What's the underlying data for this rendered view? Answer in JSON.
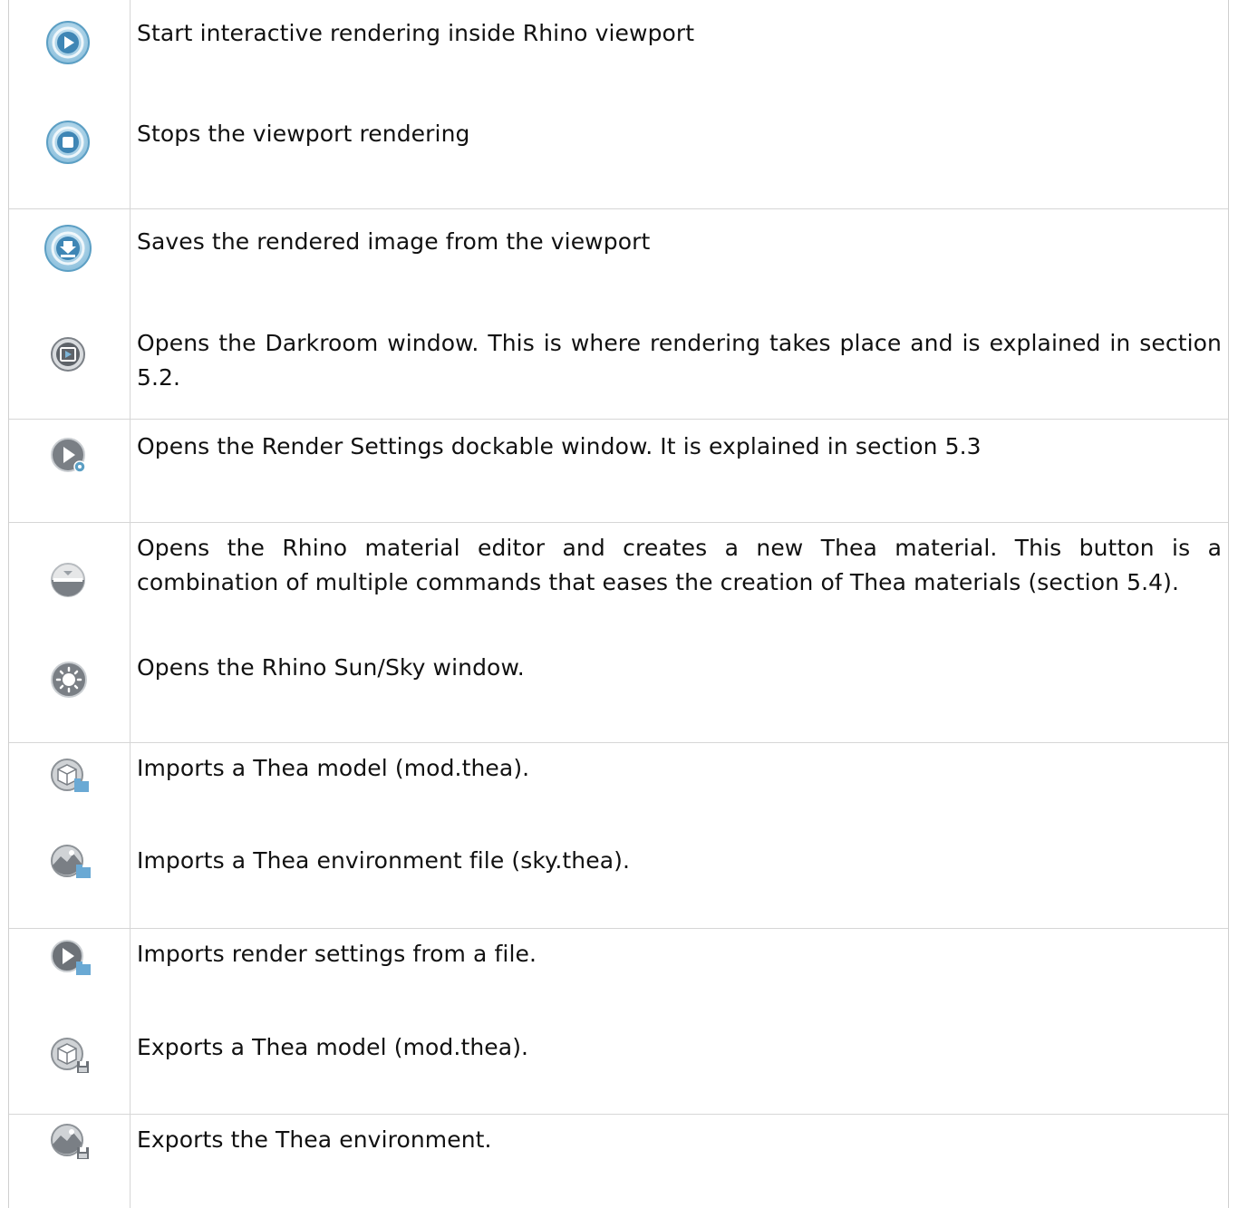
{
  "rows": [
    {
      "icon": "start-interactive-render-icon",
      "text": "Start interactive rendering inside Rhino viewport"
    },
    {
      "icon": "stop-render-icon",
      "text": "Stops the viewport rendering"
    },
    {
      "icon": "save-render-icon",
      "text": "Saves the rendered image from the viewport"
    },
    {
      "icon": "darkroom-icon",
      "text": "Opens the Darkroom window. This is where rendering takes place and is explained in section 5.2."
    },
    {
      "icon": "render-settings-icon",
      "text": "Opens the Render Settings dockable window. It is explained in section 5.3"
    },
    {
      "icon": "material-editor-icon",
      "text": "Opens the Rhino material editor and creates a new Thea material. This button is a combination of multiple commands that eases the creation of Thea materials (section 5.4)."
    },
    {
      "icon": "sun-sky-icon",
      "text": "Opens the Rhino Sun/Sky window."
    },
    {
      "icon": "import-model-icon",
      "text": "Imports a Thea model (mod.thea)."
    },
    {
      "icon": "import-environment-icon",
      "text": "Imports a Thea environment file (sky.thea)."
    },
    {
      "icon": "import-render-settings-icon",
      "text": "Imports render settings from a file."
    },
    {
      "icon": "export-model-icon",
      "text": "Exports a Thea model (mod.thea)."
    },
    {
      "icon": "export-environment-icon",
      "text": "Exports the Thea environment."
    }
  ],
  "colors": {
    "blue_ring": "#5c9fc4",
    "gray_icon": "#6d7278",
    "folder_blue": "#6aa9d4"
  }
}
